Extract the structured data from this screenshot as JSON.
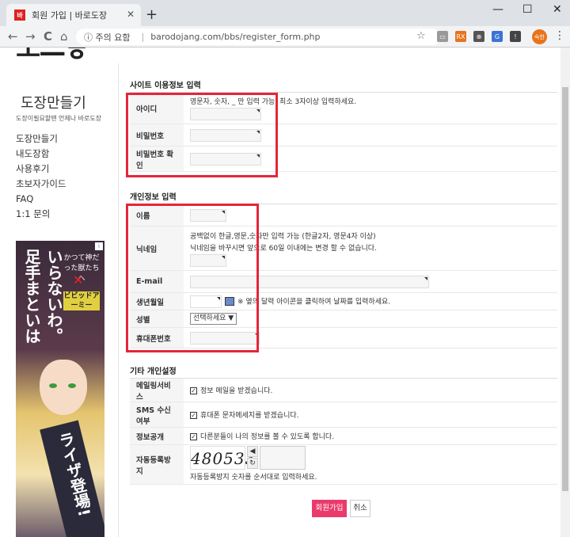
{
  "browser": {
    "tab_title": "회원 가입 | 바로도장",
    "tab_close": "✕",
    "new_tab": "+",
    "minimize": "—",
    "maximize": "☐",
    "close": "✕",
    "back": "←",
    "forward": "→",
    "reload": "C",
    "home": "⌂",
    "security_label": "ⓘ 주의 요함",
    "url": "barodojang.com/bbs/register_form.php",
    "profile_label": "숙한"
  },
  "sidebar": {
    "logo_fragment": "ㅗ—ㅎ",
    "site_title": "도장만들기",
    "site_subtitle": "도장이필요할땐 언제나 바로도장",
    "nav": [
      "도장만들기",
      "내도장함",
      "사용후기",
      "초보자가이드",
      "FAQ",
      "1:1 문의"
    ]
  },
  "ad": {
    "line1": "足手まといは",
    "line2": "いらないわ。",
    "logo1": "かつて神だった獣たちへ",
    "logo_x": "✕",
    "logo2": "ビビッドアーミー",
    "line3": "ライザ登場!"
  },
  "section_site": {
    "title": "사이트 이용정보 입력",
    "id_label": "아이디",
    "id_help": "영문자, 숫자, _ 만 입력 가능. 최소 3자이상 입력하세요.",
    "pw_label": "비밀번호",
    "pw_confirm_label": "비밀번호 확인"
  },
  "section_personal": {
    "title": "개인정보 입력",
    "name_label": "이름",
    "nick_label": "닉네임",
    "nick_help1": "공백없이 한글,영문,숫자만 입력 가능 (한글2자, 영문4자 이상)",
    "nick_help2": "닉네임을 바꾸시면 앞으로 60일 이내에는 변경 할 수 없습니다.",
    "email_label": "E-mail",
    "birth_label": "생년월일",
    "birth_help": "※ 옆의 달력 아이콘을 클릭하여 날짜를 입력하세요.",
    "gender_label": "성별",
    "gender_selected": "선택하세요 ▼",
    "phone_label": "휴대폰번호"
  },
  "section_other": {
    "title": "기타 개인설정",
    "mailing_label": "메일링서비스",
    "mailing_text": "정보 메일을 받겠습니다.",
    "sms_label": "SMS 수신여부",
    "sms_text": "휴대폰 문자메세지를 받겠습니다.",
    "open_label": "정보공개",
    "open_text": "다른분들이 나의 정보를 볼 수 있도록 합니다.",
    "captcha_label": "자동등록방지",
    "captcha_value": "480533",
    "captcha_audio": "◀",
    "captcha_refresh": "↻",
    "captcha_help": "자동등록방지 숫자를 순서대로 입력하세요."
  },
  "buttons": {
    "submit": "회원가입",
    "cancel": "취소"
  },
  "colors": {
    "highlight": "#e4263a",
    "submit": "#ea3a6b"
  }
}
